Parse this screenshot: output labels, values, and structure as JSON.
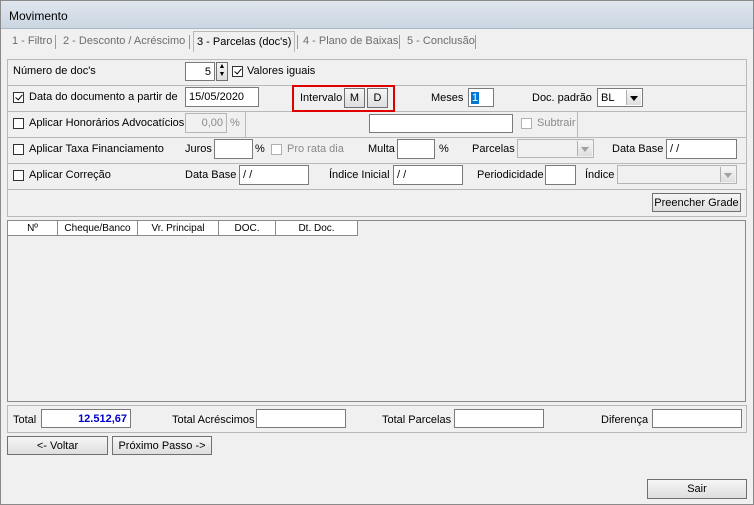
{
  "window": {
    "title": "Movimento"
  },
  "tabs": [
    {
      "label": "1 - Filtro"
    },
    {
      "label": "2 - Desconto / Acréscimo"
    },
    {
      "label": "3 - Parcelas (doc's)"
    },
    {
      "label": "4 - Plano de Baixas"
    },
    {
      "label": "5 - Conclusão"
    }
  ],
  "form": {
    "num_docs_label": "Número de doc's",
    "num_docs_value": "5",
    "valores_iguais_label": "Valores iguais",
    "data_doc_label": "Data do documento a partir de",
    "data_doc_value": "15/05/2020",
    "intervalo_label": "Intervalo",
    "intervalo_m": "M",
    "intervalo_d": "D",
    "meses_label": "Meses",
    "meses_value": "1",
    "doc_padrao_label": "Doc. padrão",
    "doc_padrao_value": "BL",
    "honorarios_label": "Aplicar Honorários Advocatícios",
    "honorarios_value": "0,00",
    "honorarios_unit": "%",
    "subtrair_label": "Subtrair",
    "taxa_label": "Aplicar Taxa Financiamento",
    "juros_label": "Juros",
    "juros_unit": "%",
    "pro_rata_label": "Pro rata dia",
    "multa_label": "Multa",
    "multa_unit": "%",
    "parcelas_label": "Parcelas",
    "data_base_label": "Data Base",
    "data_base_value": " / /",
    "correcao_label": "Aplicar Correção",
    "correcao_data_base_label": "Data Base",
    "correcao_data_base_value": " / /",
    "indice_inicial_label": "Índice Inicial",
    "indice_inicial_value": " / /",
    "periodicidade_label": "Periodicidade",
    "indice_label": "Índice",
    "preencher_grade_button": "Preencher Grade"
  },
  "grid": {
    "columns": [
      "Nº",
      "Cheque/Banco",
      "Vr. Principal",
      "DOC.",
      "Dt. Doc."
    ]
  },
  "totals": {
    "total_label": "Total",
    "total_value": "12.512,67",
    "total_acrescimos_label": "Total Acréscimos",
    "total_parcelas_label": "Total Parcelas",
    "diferenca_label": "Diferença"
  },
  "nav": {
    "voltar_button": "<- Voltar",
    "proximo_button": "Próximo Passo ->",
    "sair_button": "Sair"
  },
  "colors": {
    "highlight_border": "#e00000",
    "total_value_color": "#0000cc"
  }
}
